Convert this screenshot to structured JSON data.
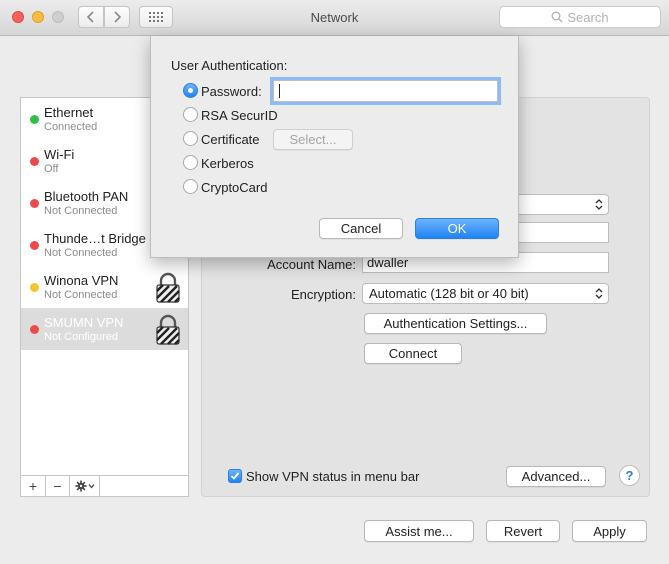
{
  "window": {
    "title": "Network",
    "search_placeholder": "Search"
  },
  "services": [
    {
      "name": "Ethernet",
      "status": "Connected",
      "color": "#30c048",
      "locked": false,
      "selected": false
    },
    {
      "name": "Wi-Fi",
      "status": "Off",
      "color": "#ef4a4a",
      "locked": false,
      "selected": false
    },
    {
      "name": "Bluetooth PAN",
      "status": "Not Connected",
      "color": "#ef4a4a",
      "locked": false,
      "selected": false
    },
    {
      "name": "Thunde…t Bridge",
      "status": "Not Connected",
      "color": "#ef4a4a",
      "locked": false,
      "selected": false
    },
    {
      "name": "Winona VPN",
      "status": "Not Connected",
      "color": "#f5c32c",
      "locked": true,
      "selected": false
    },
    {
      "name": "SMUMN VPN",
      "status": "Not Configured",
      "color": "#ef4a4a",
      "locked": true,
      "selected": true
    }
  ],
  "sidebar_controls": {
    "add": "+",
    "remove": "−",
    "gear_icon": "gear-icon"
  },
  "detail": {
    "account_name_label": "Account Name:",
    "account_name_value": "dwaller",
    "encryption_label": "Encryption:",
    "encryption_value": "Automatic (128 bit or 40 bit)",
    "auth_settings_label": "Authentication Settings...",
    "connect_label": "Connect",
    "show_vpn_status_label": "Show VPN status in menu bar",
    "show_vpn_status_checked": true,
    "advanced_label": "Advanced...",
    "help_label": "?"
  },
  "sheet": {
    "title": "User Authentication:",
    "options": [
      {
        "label": "Password:",
        "checked": true
      },
      {
        "label": "RSA SecurID",
        "checked": false
      },
      {
        "label": "Certificate",
        "checked": false
      },
      {
        "label": "Kerberos",
        "checked": false
      },
      {
        "label": "CryptoCard",
        "checked": false
      }
    ],
    "password_value": "",
    "select_label": "Select...",
    "cancel_label": "Cancel",
    "ok_label": "OK"
  },
  "footer": {
    "assist_label": "Assist me...",
    "revert_label": "Revert",
    "apply_label": "Apply"
  },
  "colors": {
    "accent": "#1f83f5",
    "selected_row": "#dcdcdc"
  }
}
